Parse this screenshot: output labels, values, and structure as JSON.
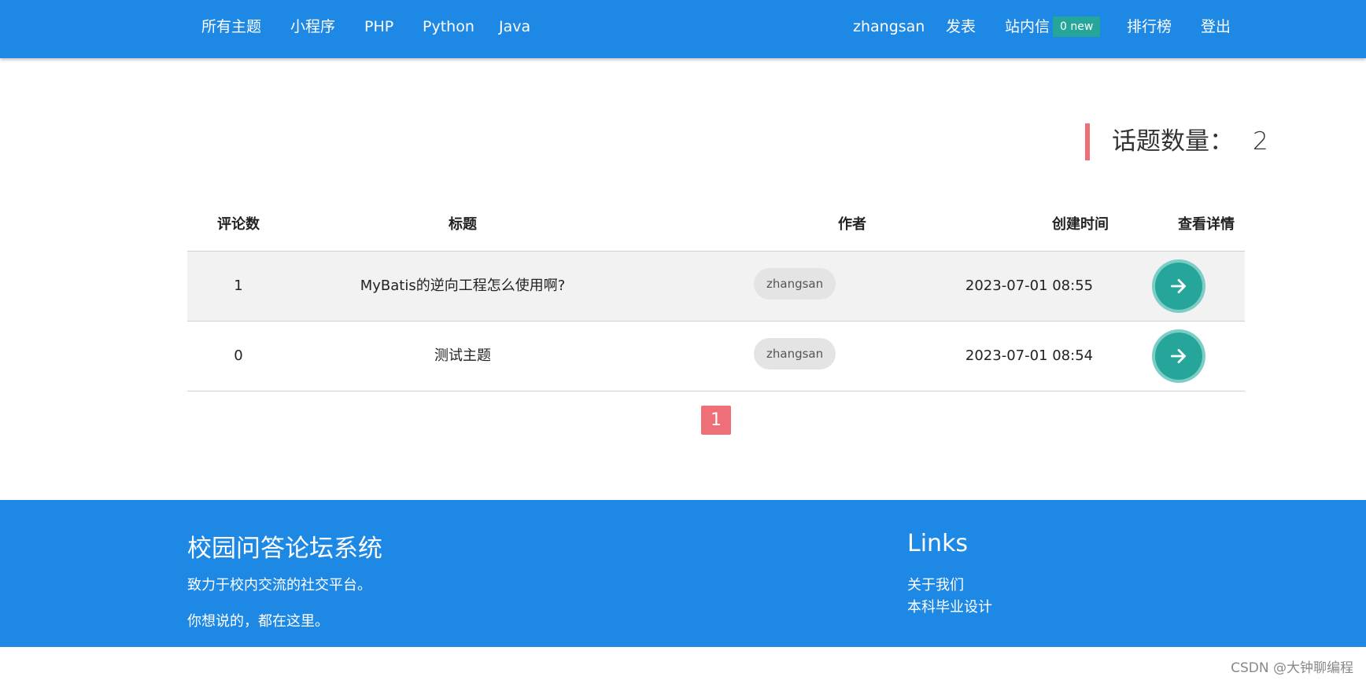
{
  "nav": {
    "left_items": [
      "所有主题",
      "小程序",
      "PHP",
      "Python",
      "Java"
    ],
    "username": "zhangsan",
    "post": "发表",
    "messages": "站内信",
    "messages_badge": "0 new",
    "leaderboard": "排行榜",
    "logout": "登出"
  },
  "summary": {
    "label": "话题数量：",
    "count": "2"
  },
  "table": {
    "headers": [
      "评论数",
      "标题",
      "作者",
      "创建时间",
      "查看详情"
    ],
    "rows": [
      {
        "comments": "1",
        "title": "MyBatis的逆向工程怎么使用啊?",
        "author": "zhangsan",
        "created": "2023-07-01 08:55"
      },
      {
        "comments": "0",
        "title": "测试主题",
        "author": "zhangsan",
        "created": "2023-07-01 08:54"
      }
    ]
  },
  "pagination": {
    "current": "1"
  },
  "footer": {
    "title": "校园问答论坛系统",
    "line1": "致力于校内交流的社交平台。",
    "line2": "你想说的，都在这里。",
    "links_title": "Links",
    "links": [
      "关于我们",
      "本科毕业设计"
    ]
  },
  "watermark": "CSDN @大钟聊编程",
  "colors": {
    "primary": "#1e88e5",
    "accent": "#ef6f78",
    "teal": "#26a69a"
  },
  "icons": {
    "detail_button": "arrow-forward-icon"
  }
}
